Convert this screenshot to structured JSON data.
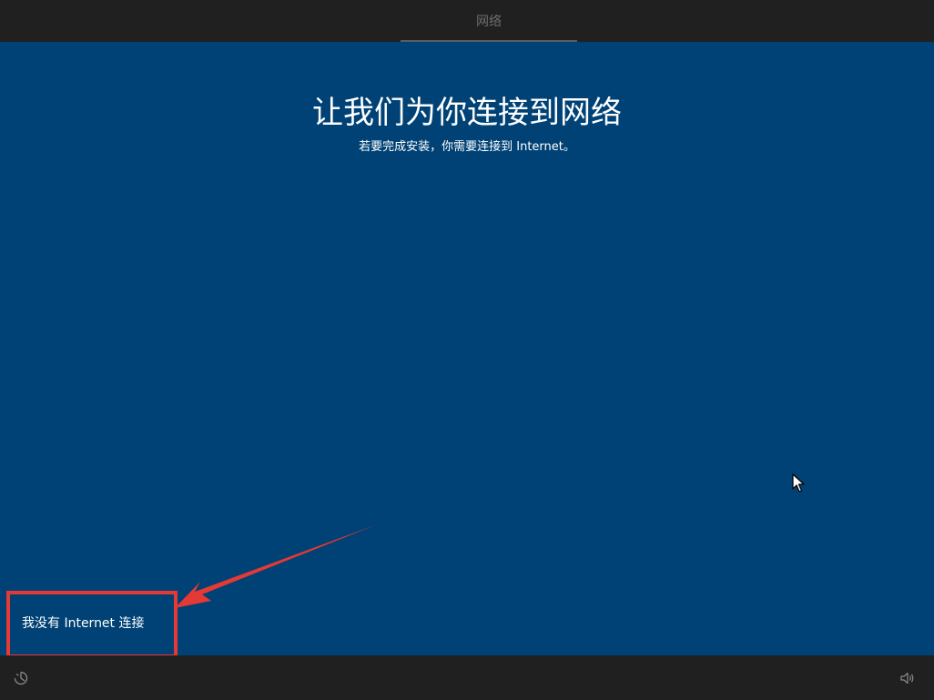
{
  "topbar": {
    "step_title": "网络"
  },
  "main": {
    "title": "让我们为你连接到网络",
    "subtitle": "若要完成安装，你需要连接到 Internet。",
    "no_internet_link": "我没有 Internet 连接"
  },
  "icons": {
    "ease_of_access": "ease-of-access-icon",
    "volume": "volume-icon",
    "cursor": "mouse-pointer-icon",
    "annotation_arrow": "arrow-icon"
  },
  "colors": {
    "background": "#004275",
    "bars": "#202020",
    "annotation": "#e53935",
    "progress_indicator": "#5c5c5c"
  }
}
